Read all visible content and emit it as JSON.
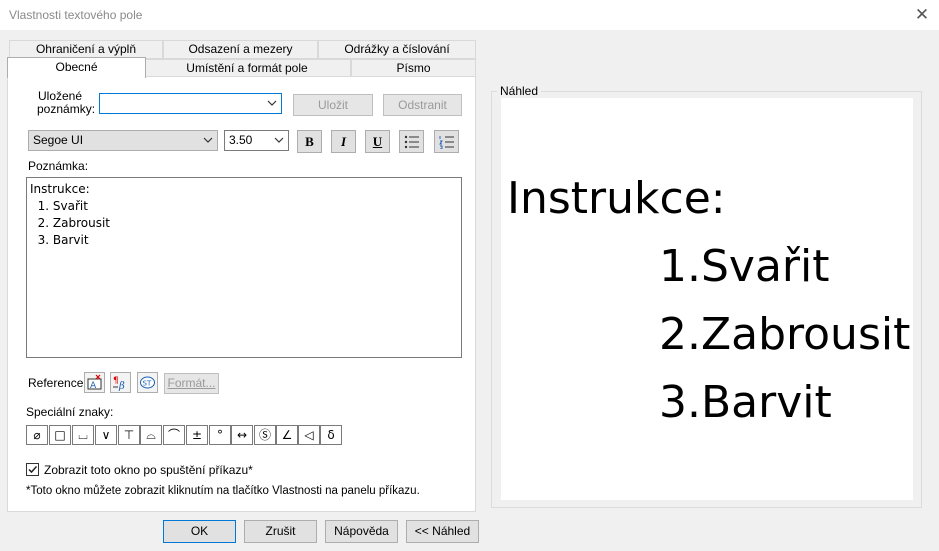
{
  "window": {
    "title": "Vlastnosti textového pole",
    "close_glyph": "✕"
  },
  "tabs_row1": [
    "Ohraničení a výplň",
    "Odsazení a mezery",
    "Odrážky a číslování"
  ],
  "tabs_row2": [
    "Obecné",
    "Umístění a formát pole",
    "Písmo"
  ],
  "saved_notes": {
    "label_line1": "Uložené",
    "label_line2": "poznámky:",
    "value": "",
    "save_label": "Uložit",
    "remove_label": "Odstranit"
  },
  "font": {
    "family": "Segoe UI",
    "size": "3.50"
  },
  "format_buttons": {
    "bold": "B",
    "italic": "I",
    "underline": "U"
  },
  "note": {
    "label": "Poznámka:",
    "lines": [
      "Instrukce:",
      "  1. Svařit",
      "  2. Zabrousit",
      "  3. Barvit"
    ]
  },
  "reference": {
    "label": "Reference:",
    "format_label": "Formát..."
  },
  "special_chars": {
    "label": "Speciální znaky:",
    "symbols": [
      "⌀",
      "□",
      "⌴",
      "∨",
      "⊤",
      "⌓",
      "⌒",
      "±",
      "°",
      "↔",
      "Ⓢ",
      "∠",
      "◁",
      "δ"
    ]
  },
  "show_option": {
    "label": "Zobrazit toto okno po spuštění příkazu*",
    "checked": true
  },
  "footnote": "*Toto okno můžete zobrazit kliknutím na tlačítko Vlastnosti na panelu příkazu.",
  "preview": {
    "label": "Náhled",
    "lines": [
      "Instrukce:",
      "1.Svařit",
      "2.Zabrousit",
      "3.Barvit"
    ]
  },
  "buttons": {
    "ok": "OK",
    "cancel": "Zrušit",
    "help": "Nápověda",
    "preview": "<< Náhled"
  }
}
